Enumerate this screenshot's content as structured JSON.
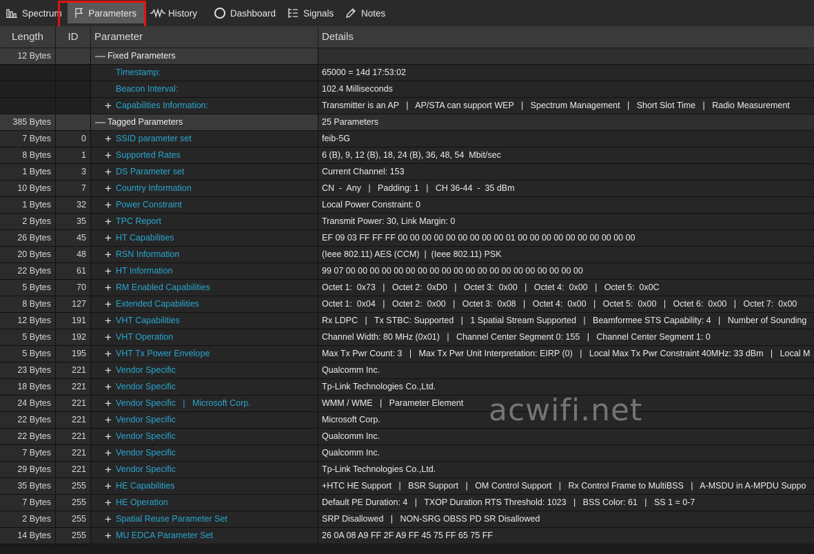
{
  "tabs": [
    {
      "label": "Spectrum",
      "icon": "bar-chart-icon"
    },
    {
      "label": "Parameters",
      "icon": "flag-icon"
    },
    {
      "label": "History",
      "icon": "waveform-icon"
    },
    {
      "label": "Dashboard",
      "icon": "circle-icon"
    },
    {
      "label": "Signals",
      "icon": "list-icon"
    },
    {
      "label": "Notes",
      "icon": "pencil-icon"
    }
  ],
  "columns": {
    "length": "Length",
    "id": "ID",
    "parameter": "Parameter",
    "details": "Details"
  },
  "fixed_group": {
    "length": "12 Bytes",
    "label": "Fixed Parameters",
    "details": ""
  },
  "fixed_rows": [
    {
      "label": "Timestamp:",
      "details": "65000 = 14d 17:53:02",
      "expand": false
    },
    {
      "label": "Beacon Interval:",
      "details": "102.4 Milliseconds",
      "expand": false
    },
    {
      "label": "Capabilities Information:",
      "details": "Transmitter is an AP   |   AP/STA can support WEP   |   Spectrum Management   |   Short Slot Time   |   Radio Measurement",
      "expand": true
    }
  ],
  "tagged_group": {
    "length": "385 Bytes",
    "label": "Tagged Parameters",
    "details": "25 Parameters"
  },
  "tagged_rows": [
    {
      "length": "7 Bytes",
      "id": "0",
      "label": "SSID parameter set",
      "details": "feib-5G"
    },
    {
      "length": "8 Bytes",
      "id": "1",
      "label": "Supported Rates",
      "details": "6 (B), 9, 12 (B), 18, 24 (B), 36, 48, 54  Mbit/sec"
    },
    {
      "length": "1 Bytes",
      "id": "3",
      "label": "DS Parameter set",
      "details": "Current Channel: 153"
    },
    {
      "length": "10 Bytes",
      "id": "7",
      "label": "Country Information",
      "details": "CN  -  Any   |   Padding: 1   |   CH 36-44  -  35 dBm"
    },
    {
      "length": "1 Bytes",
      "id": "32",
      "label": "Power Constraint",
      "details": "Local Power Constraint: 0"
    },
    {
      "length": "2 Bytes",
      "id": "35",
      "label": "TPC Report",
      "details": "Transmit Power: 30, Link Margin: 0"
    },
    {
      "length": "26 Bytes",
      "id": "45",
      "label": "HT Capabilities",
      "details": "EF 09 03 FF FF FF 00 00 00 00 00 00 00 00 00 01 00 00 00 00 00 00 00 00 00 00"
    },
    {
      "length": "20 Bytes",
      "id": "48",
      "label": "RSN Information",
      "details": "(Ieee 802.11) AES (CCM)  |  (Ieee 802.11) PSK"
    },
    {
      "length": "22 Bytes",
      "id": "61",
      "label": "HT Information",
      "details": "99 07 00 00 00 00 00 00 00 00 00 00 00 00 00 00 00 00 00 00 00 00"
    },
    {
      "length": "5 Bytes",
      "id": "70",
      "label": "RM Enabled Capabilities",
      "details": "Octet 1:  0x73   |   Octet 2:  0xD0   |   Octet 3:  0x00   |   Octet 4:  0x00   |   Octet 5:  0x0C"
    },
    {
      "length": "8 Bytes",
      "id": "127",
      "label": "Extended Capabilities",
      "details": "Octet 1:  0x04   |   Octet 2:  0x00   |   Octet 3:  0x08   |   Octet 4:  0x00   |   Octet 5:  0x00   |   Octet 6:  0x00   |   Octet 7:  0x00"
    },
    {
      "length": "12 Bytes",
      "id": "191",
      "label": "VHT Capabilities",
      "details": "Rx LDPC   |   Tx STBC: Supported   |   1 Spatial Stream Supported   |   Beamformee STS Capability: 4   |   Number of Sounding"
    },
    {
      "length": "5 Bytes",
      "id": "192",
      "label": "VHT Operation",
      "details": "Channel Width: 80 MHz (0x01)   |   Channel Center Segment 0: 155   |   Channel Center Segment 1: 0"
    },
    {
      "length": "5 Bytes",
      "id": "195",
      "label": "VHT Tx Power Envelope",
      "details": "Max Tx Pwr Count: 3   |   Max Tx Pwr Unit Interpretation: EIRP (0)   |   Local Max Tx Pwr Constraint 40MHz: 33 dBm   |   Local M"
    },
    {
      "length": "23 Bytes",
      "id": "221",
      "label": "Vendor Specific",
      "details": "Qualcomm Inc."
    },
    {
      "length": "18 Bytes",
      "id": "221",
      "label": "Vendor Specific",
      "details": "Tp-Link Technologies Co.,Ltd."
    },
    {
      "length": "24 Bytes",
      "id": "221",
      "label": "Vendor Specific",
      "label_extra": "Microsoft Corp.",
      "details": "WMM / WME   |   Parameter Element"
    },
    {
      "length": "22 Bytes",
      "id": "221",
      "label": "Vendor Specific",
      "details": "Microsoft Corp."
    },
    {
      "length": "22 Bytes",
      "id": "221",
      "label": "Vendor Specific",
      "details": "Qualcomm Inc."
    },
    {
      "length": "7 Bytes",
      "id": "221",
      "label": "Vendor Specific",
      "details": "Qualcomm Inc."
    },
    {
      "length": "29 Bytes",
      "id": "221",
      "label": "Vendor Specific",
      "details": "Tp-Link Technologies Co.,Ltd."
    },
    {
      "length": "35 Bytes",
      "id": "255",
      "label": "HE Capabilities",
      "details": "+HTC HE Support   |   BSR Support   |   OM Control Support   |   Rx Control Frame to MultiBSS   |   A-MSDU in A-MPDU Suppo"
    },
    {
      "length": "7 Bytes",
      "id": "255",
      "label": "HE Operation",
      "details": "Default PE Duration: 4   |   TXOP Duration RTS Threshold: 1023   |   BSS Color: 61   |   SS 1 = 0-7"
    },
    {
      "length": "2 Bytes",
      "id": "255",
      "label": "Spatial Reuse Parameter Set",
      "details": "SRP Disallowed   |   NON-SRG OBSS PD SR Disallowed"
    },
    {
      "length": "14 Bytes",
      "id": "255",
      "label": "MU EDCA Parameter Set",
      "details": "26 0A 08 A9 FF 2F A9 FF 45 75 FF 65 75 FF"
    }
  ],
  "watermark": "acwifi.net"
}
